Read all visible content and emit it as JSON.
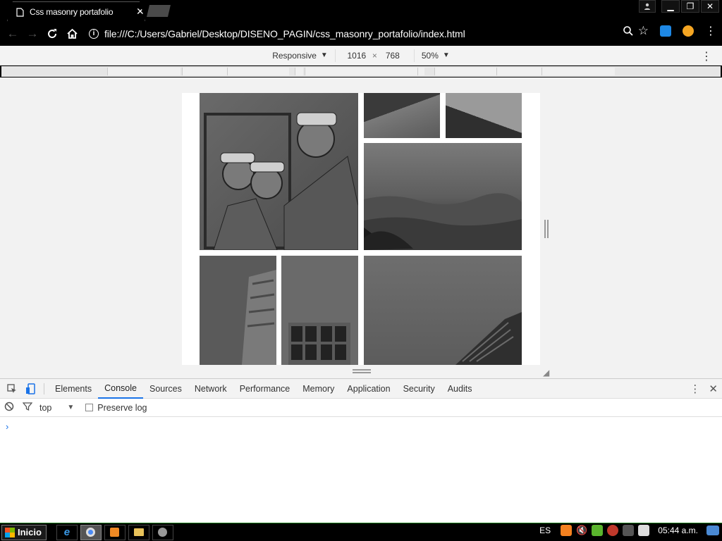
{
  "browser": {
    "tab_title": "Css masonry portafolio",
    "tab_close": "✕",
    "window_buttons": [
      "▁",
      "❐",
      "✕"
    ],
    "url": "file:///C:/Users/Gabriel/Desktop/DISENO_PAGIN/css_masonry_portafolio/index.html"
  },
  "device_toolbar": {
    "mode": "Responsive",
    "width": "1016",
    "height": "768",
    "times": "×",
    "zoom": "50%"
  },
  "devtools": {
    "tabs": [
      "Elements",
      "Console",
      "Sources",
      "Network",
      "Performance",
      "Memory",
      "Application",
      "Security",
      "Audits"
    ],
    "active_tab": "Console",
    "context": "top",
    "preserve_log": "Preserve log",
    "prompt": "›"
  },
  "taskbar": {
    "start_label": "Inicio",
    "language": "ES",
    "clock": "05:44 a.m."
  },
  "colors": {
    "accent": "#1a73e8",
    "taskbar_border": "#1c7c1c"
  }
}
